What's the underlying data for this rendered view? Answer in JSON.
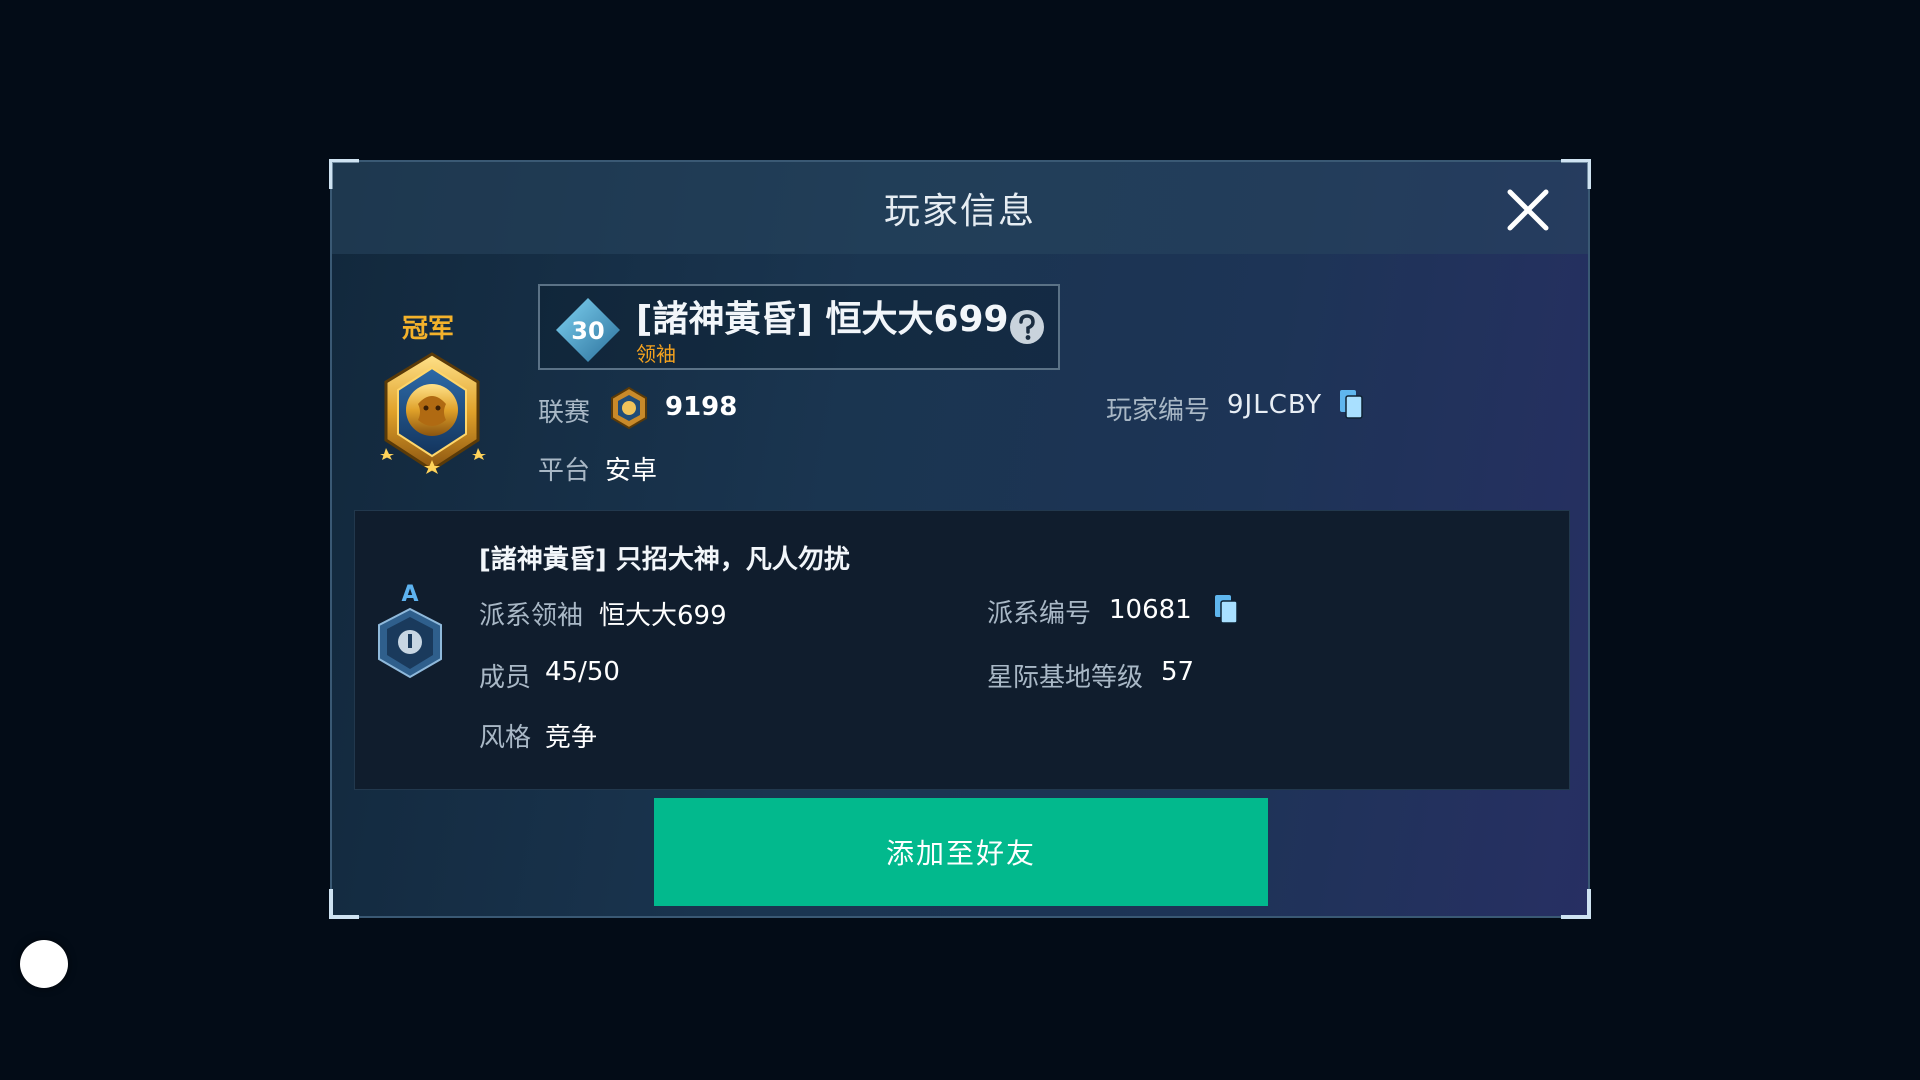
{
  "dialog": {
    "title": "玩家信息"
  },
  "player": {
    "rank_label": "冠军",
    "level": "30",
    "name": "[諸神黃昏] 恒大大699",
    "role": "领袖",
    "league_label": "联赛",
    "league_score": "9198",
    "platform_label": "平台",
    "platform_value": "安卓",
    "id_label": "玩家编号",
    "id_value": "9JLCBY"
  },
  "faction": {
    "grade": "A",
    "name": "[諸神黃昏]  只招大神，凡人勿扰",
    "leader_label": "派系领袖",
    "leader_value": "恒大大699",
    "id_label": "派系编号",
    "id_value": "10681",
    "members_label": "成员",
    "members_value": "45/50",
    "base_level_label": "星际基地等级",
    "base_level_value": "57",
    "style_label": "风格",
    "style_value": "竞争"
  },
  "actions": {
    "add_friend": "添加至好友"
  },
  "colors": {
    "accent_green": "#02b98d",
    "role_orange": "#f4a21e",
    "rank_gold": "#f4b22b",
    "copy_blue": "#8fd0ff"
  }
}
